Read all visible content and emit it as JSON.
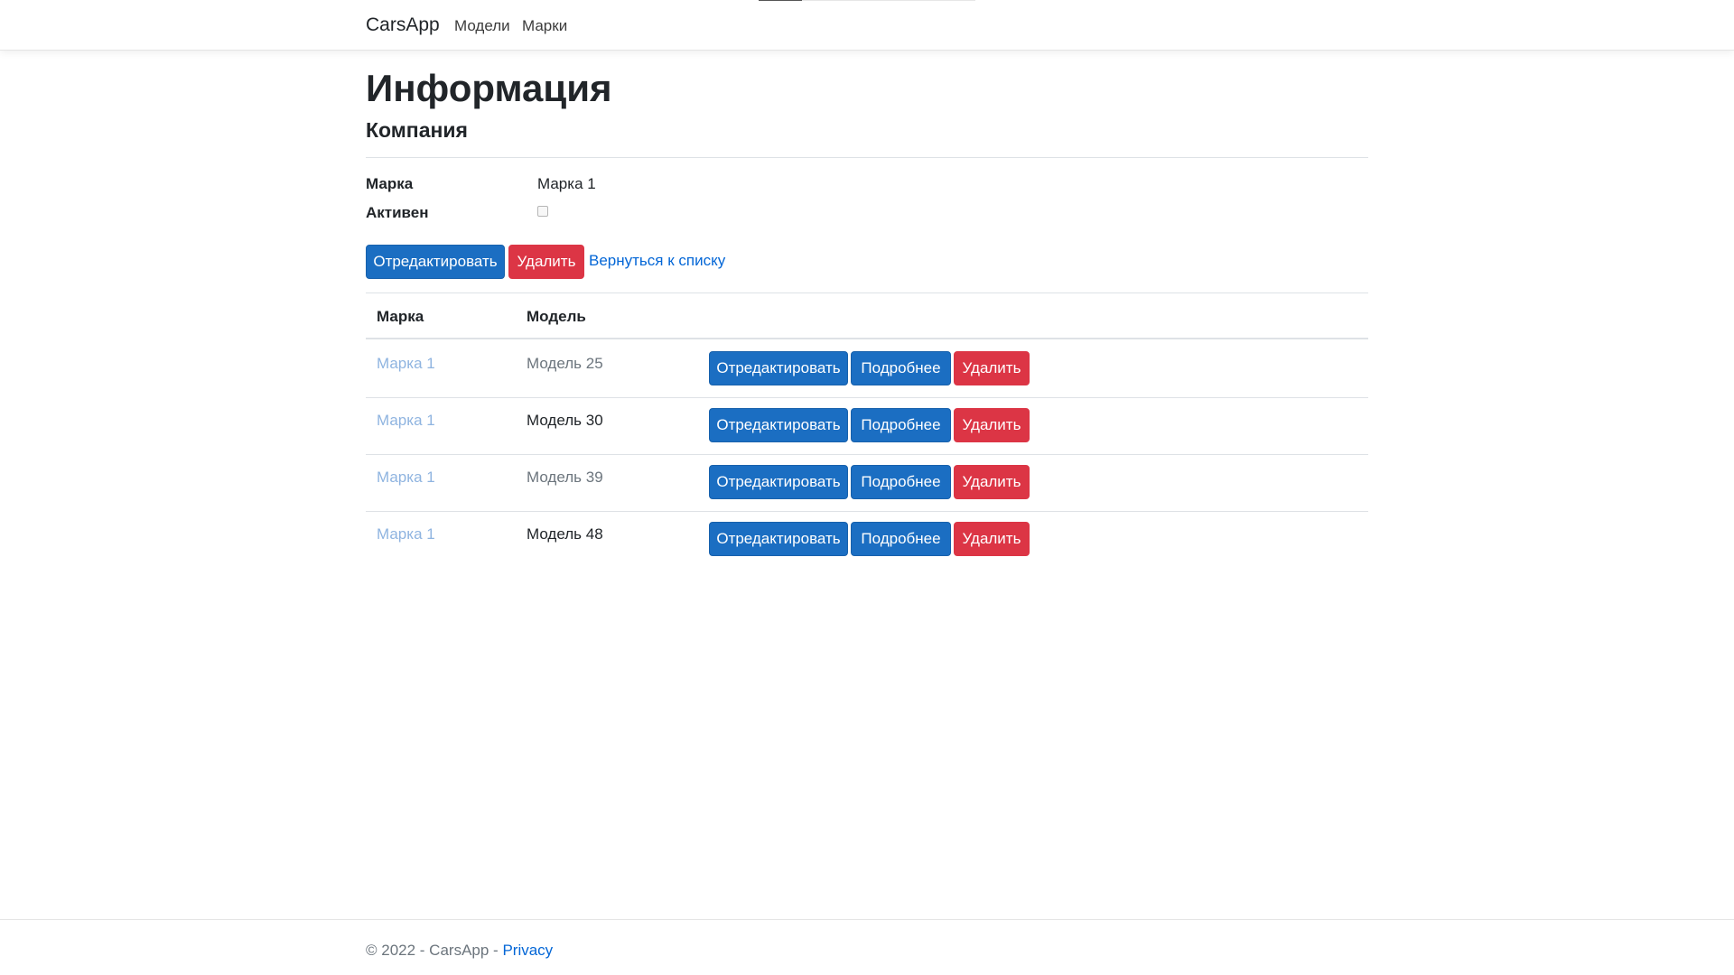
{
  "nav": {
    "brand": "CarsApp",
    "links": [
      "Модели",
      "Марки"
    ],
    "loading_progress": 0.2
  },
  "page": {
    "title": "Информация",
    "subtitle": "Компания"
  },
  "details": [
    {
      "label": "Марка",
      "value": "Марка 1"
    },
    {
      "label": "Активен",
      "value": "",
      "checked": false
    }
  ],
  "actions": {
    "edit": "Отредактировать",
    "delete": "Удалить",
    "back": "Вернуться к списку"
  },
  "table": {
    "headers": [
      "Марка",
      "Модель"
    ],
    "rows": [
      {
        "brand": "Марка 1",
        "model": "Модель 25",
        "model_color": "#6c757d"
      },
      {
        "brand": "Марка 1",
        "model": "Модель 30",
        "model_color": "#212529"
      },
      {
        "brand": "Марка 1",
        "model": "Модель 39",
        "model_color": "#6c757d"
      },
      {
        "brand": "Марка 1",
        "model": "Модель 48",
        "model_color": "#212529"
      }
    ],
    "row_actions": {
      "edit": "Отредактировать",
      "details": "Подробнее",
      "delete": "Удалить"
    }
  },
  "footer": {
    "copyright": "© 2022 - CarsApp - ",
    "privacy": "Privacy"
  },
  "colors": {
    "primary": "#1b6ec2",
    "danger": "#dc3545",
    "link": "#0366d6",
    "faded_link": "#8fb4e0"
  }
}
